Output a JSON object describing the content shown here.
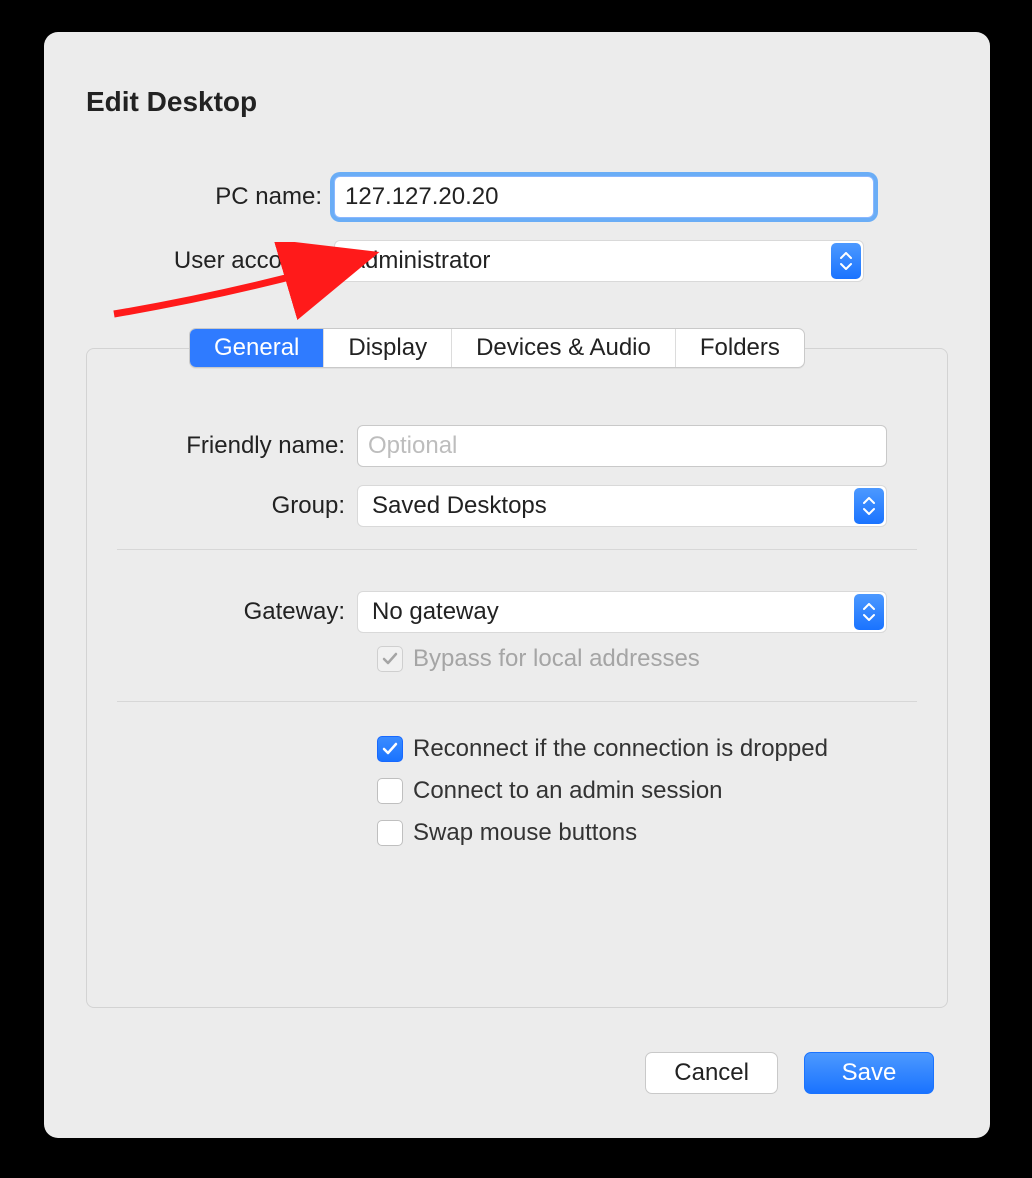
{
  "title": "Edit Desktop",
  "pc_name": {
    "label": "PC name:",
    "value": "127.127.20.20"
  },
  "user_account": {
    "label": "User account:",
    "selected": "Administrator"
  },
  "tabs": {
    "items": [
      "General",
      "Display",
      "Devices & Audio",
      "Folders"
    ],
    "active_index": 0
  },
  "general": {
    "friendly_name": {
      "label": "Friendly name:",
      "placeholder": "Optional",
      "value": ""
    },
    "group": {
      "label": "Group:",
      "selected": "Saved Desktops"
    },
    "gateway": {
      "label": "Gateway:",
      "selected": "No gateway"
    },
    "bypass": {
      "label": "Bypass for local addresses",
      "checked": true,
      "disabled": true
    },
    "reconnect": {
      "label": "Reconnect if the connection is dropped",
      "checked": true
    },
    "admin_session": {
      "label": "Connect to an admin session",
      "checked": false
    },
    "swap_mouse": {
      "label": "Swap mouse buttons",
      "checked": false
    }
  },
  "buttons": {
    "cancel": "Cancel",
    "save": "Save"
  },
  "colors": {
    "accent": "#1a73ff",
    "arrow": "#ff1a1a"
  }
}
